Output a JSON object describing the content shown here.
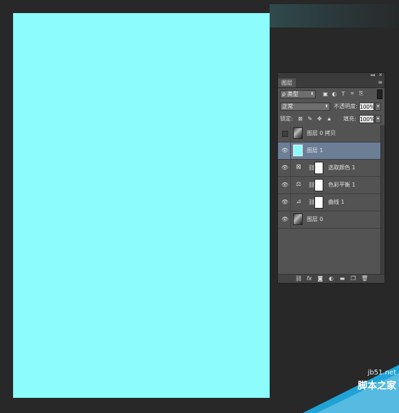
{
  "panel": {
    "tab_label": "图层",
    "collapse_glyph": "◂◂",
    "close_glyph": "✕",
    "menu_glyph": "≡",
    "filter": {
      "value": "ρ 类型",
      "arrow": "⬍"
    },
    "filter_icons": [
      "image-filter-icon",
      "adjustment-filter-icon",
      "type-filter-icon",
      "shape-filter-icon",
      "smart-object-filter-icon"
    ],
    "blend_mode": {
      "value": "正常",
      "arrow": "⬍"
    },
    "opacity": {
      "label": "不透明度:",
      "value": "100%",
      "arrow": "▾"
    },
    "lock": {
      "label": "锁定:"
    },
    "fill": {
      "label": "填充:",
      "value": "100%",
      "arrow": "▾"
    },
    "layers": [
      {
        "name": "图层 0 拷贝",
        "visible": false,
        "kind": "photo",
        "selected": false
      },
      {
        "name": "图层 1",
        "visible": true,
        "kind": "fill-cyan",
        "selected": true
      },
      {
        "name": "选取颜色 1",
        "visible": true,
        "kind": "adjustment",
        "icon": "selective-color-icon",
        "glyph": "⊠",
        "selected": false
      },
      {
        "name": "色彩平衡 1",
        "visible": true,
        "kind": "adjustment",
        "icon": "color-balance-icon",
        "glyph": "⚖",
        "selected": false
      },
      {
        "name": "曲线 1",
        "visible": true,
        "kind": "adjustment",
        "icon": "curves-icon",
        "glyph": "⊿",
        "selected": false
      },
      {
        "name": "图层 0",
        "visible": true,
        "kind": "photo",
        "selected": false
      }
    ],
    "footer_icons": [
      "link-layers-icon",
      "fx-icon",
      "add-mask-icon",
      "adjustment-layer-icon",
      "new-group-icon",
      "new-layer-icon",
      "delete-layer-icon"
    ]
  },
  "watermark": {
    "line1": "jb51.net",
    "line2": "脚本之家"
  },
  "colors": {
    "canvas": "#8cfcfc",
    "background": "#282828",
    "selected_layer": "#6c7e96"
  }
}
